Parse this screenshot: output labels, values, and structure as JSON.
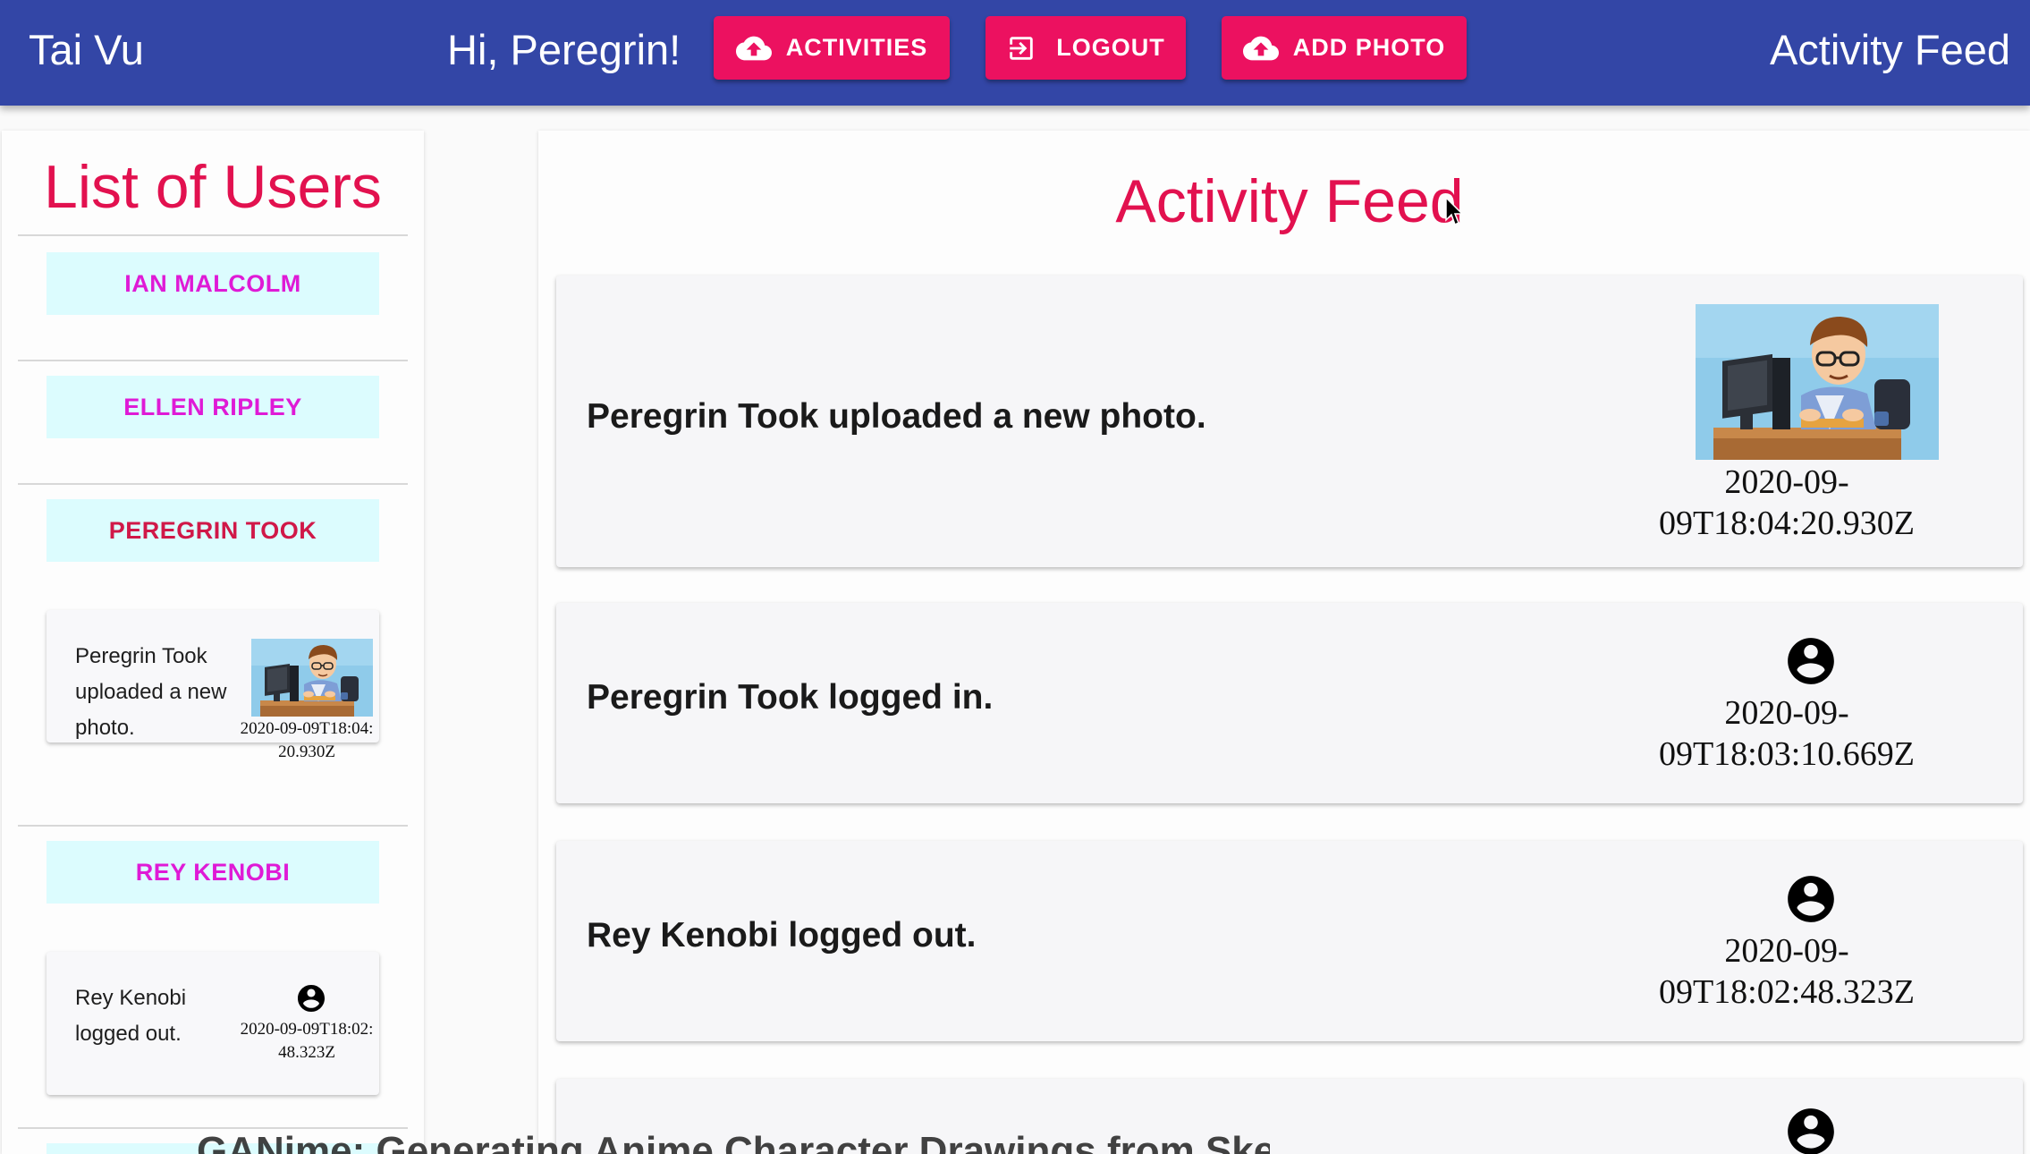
{
  "header": {
    "brand": "Tai Vu",
    "greeting": "Hi, Peregrin!",
    "page_name": "Activity Feed",
    "buttons": {
      "activities": "ACTIVITIES",
      "logout": "LOGOUT",
      "add_photo": "ADD PHOTO"
    }
  },
  "sidebar": {
    "title": "List of Users",
    "users": [
      {
        "name": "IAN MALCOLM"
      },
      {
        "name": "ELLEN RIPLEY"
      },
      {
        "name": "PEREGRIN TOOK",
        "activity": {
          "text": "Peregrin Took uploaded a new photo.",
          "time": "2020-09-09T18:04:20.930Z",
          "media": "photo"
        }
      },
      {
        "name": "REY KENOBI",
        "activity": {
          "text": "Rey Kenobi logged out.",
          "time": "2020-09-09T18:02:48.323Z",
          "media": "account-circle-icon"
        }
      }
    ]
  },
  "main": {
    "title": "Activity Feed",
    "feed": [
      {
        "text": "Peregrin Took uploaded a new photo.",
        "time_line1": "2020-09-",
        "time_line2": "09T18:04:20.930Z",
        "media": "photo"
      },
      {
        "text": "Peregrin Took logged in.",
        "time_line1": "2020-09-",
        "time_line2": "09T18:03:10.669Z",
        "media": "account-circle-icon"
      },
      {
        "text": "Rey Kenobi logged out.",
        "time_line1": "2020-09-",
        "time_line2": "09T18:02:48.323Z",
        "media": "account-circle-icon"
      }
    ]
  },
  "overlay_text": "GANime: Generating Anime Character Drawings from Sketches",
  "colors": {
    "appbar": "#3346a6",
    "accent_button": "#ec1160",
    "title": "#e2114f",
    "user_button_bg": "#dcfcfe",
    "user_button_text": "#df1ad6",
    "user_button_selected_text": "#d01848"
  }
}
